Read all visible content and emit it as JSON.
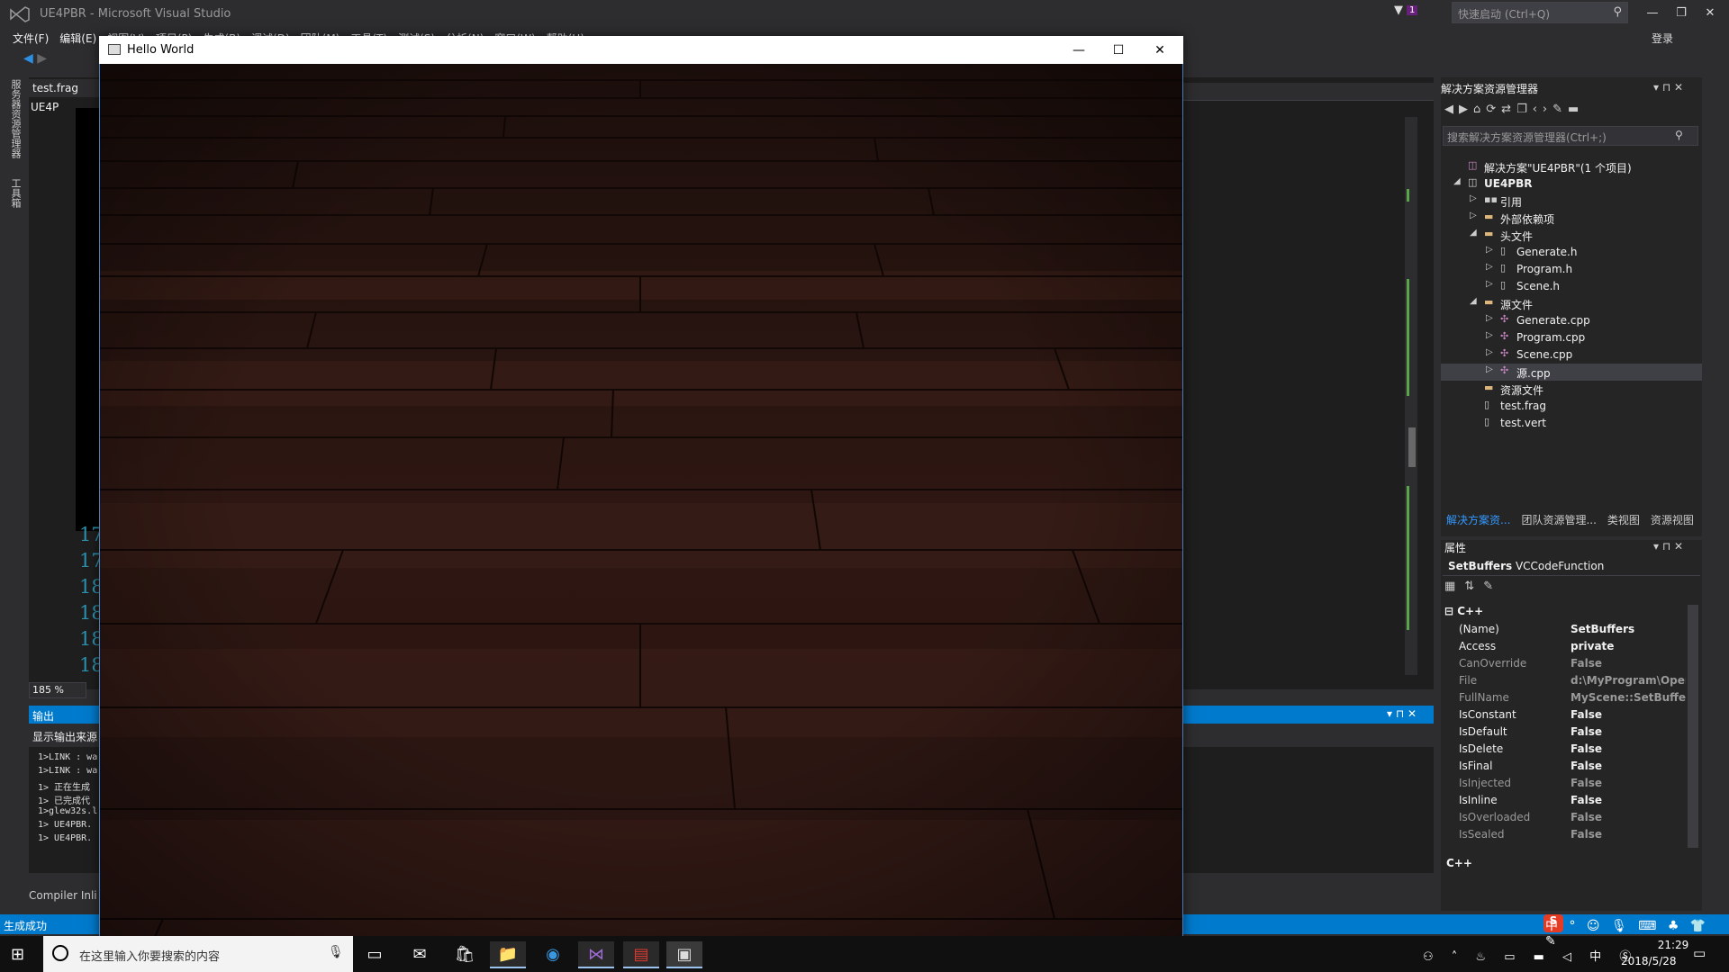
{
  "vs": {
    "title": "UE4PBR - Microsoft Visual Studio",
    "quick_launch": "快速启动 (Ctrl+Q)",
    "login": "登录",
    "notify_count": "1",
    "menu": [
      "文件(F)",
      "编辑(E)",
      "视图(V)",
      "项目(P)",
      "生成(B)",
      "调试(D)",
      "团队(M)",
      "工具(T)",
      "测试(S)",
      "分析(N)",
      "窗口(W)",
      "帮助(H)"
    ],
    "left_tabs": [
      "服务器资源管理器",
      "工具箱"
    ],
    "editor_tab": "test.frag",
    "editor_file": "UE4P",
    "line_numbers": [
      "17",
      "17",
      "18",
      "18",
      "18",
      "18"
    ],
    "zoom": "185 %",
    "output": {
      "title": "输出",
      "source_label": "显示输出来源",
      "lines": [
        "1>LINK : wa",
        "1>LINK : wa",
        "1>  正在生成",
        "1>  已完成代",
        "1>glew32s.l",
        "1>  UE4PBR.",
        "1>  UE4PBR."
      ],
      "footer": "Compiler Inli"
    },
    "status": "生成成功"
  },
  "solution_explorer": {
    "title": "解决方案资源管理器",
    "search_placeholder": "搜索解决方案资源管理器(Ctrl+;)",
    "tree": [
      {
        "label": "解决方案\"UE4PBR\"(1 个项目)",
        "level": 0,
        "expander": "",
        "icon": "solution-icon"
      },
      {
        "label": "UE4PBR",
        "level": 0,
        "expander": "◢",
        "icon": "project-icon"
      },
      {
        "label": "引用",
        "level": 1,
        "expander": "▷",
        "icon": "references-icon"
      },
      {
        "label": "外部依赖项",
        "level": 1,
        "expander": "▷",
        "icon": "folder-icon"
      },
      {
        "label": "头文件",
        "level": 1,
        "expander": "◢",
        "icon": "folder-icon"
      },
      {
        "label": "Generate.h",
        "level": 2,
        "expander": "▷",
        "icon": "header-file-icon"
      },
      {
        "label": "Program.h",
        "level": 2,
        "expander": "▷",
        "icon": "header-file-icon"
      },
      {
        "label": "Scene.h",
        "level": 2,
        "expander": "▷",
        "icon": "header-file-icon"
      },
      {
        "label": "源文件",
        "level": 1,
        "expander": "◢",
        "icon": "folder-icon"
      },
      {
        "label": "Generate.cpp",
        "level": 2,
        "expander": "▷",
        "icon": "cpp-file-icon"
      },
      {
        "label": "Program.cpp",
        "level": 2,
        "expander": "▷",
        "icon": "cpp-file-icon"
      },
      {
        "label": "Scene.cpp",
        "level": 2,
        "expander": "▷",
        "icon": "cpp-file-icon"
      },
      {
        "label": "源.cpp",
        "level": 2,
        "expander": "▷",
        "icon": "cpp-file-icon",
        "selected": true
      },
      {
        "label": "资源文件",
        "level": 1,
        "expander": "",
        "icon": "folder-icon"
      },
      {
        "label": "test.frag",
        "level": 1,
        "expander": "",
        "icon": "file-icon"
      },
      {
        "label": "test.vert",
        "level": 1,
        "expander": "",
        "icon": "file-icon"
      }
    ],
    "tabs": [
      "解决方案资...",
      "团队资源管理...",
      "类视图",
      "资源视图"
    ]
  },
  "properties": {
    "title": "属性",
    "object_name": "SetBuffers",
    "object_type": "VCCodeFunction",
    "category": "C++",
    "rows": [
      {
        "name": "(Name)",
        "value": "SetBuffers",
        "dim": false
      },
      {
        "name": "Access",
        "value": "private",
        "dim": false
      },
      {
        "name": "CanOverride",
        "value": "False",
        "dim": true
      },
      {
        "name": "File",
        "value": "d:\\MyProgram\\Oper",
        "dim": true
      },
      {
        "name": "FullName",
        "value": "MyScene::SetBuffers",
        "dim": true
      },
      {
        "name": "IsConstant",
        "value": "False",
        "dim": false
      },
      {
        "name": "IsDefault",
        "value": "False",
        "dim": false
      },
      {
        "name": "IsDelete",
        "value": "False",
        "dim": false
      },
      {
        "name": "IsFinal",
        "value": "False",
        "dim": false
      },
      {
        "name": "IsInjected",
        "value": "False",
        "dim": true
      },
      {
        "name": "IsInline",
        "value": "False",
        "dim": false
      },
      {
        "name": "IsOverloaded",
        "value": "False",
        "dim": true
      },
      {
        "name": "IsSealed",
        "value": "False",
        "dim": true
      }
    ],
    "description": "C++"
  },
  "hello_window": {
    "title": "Hello World"
  },
  "taskbar": {
    "search_placeholder": "在这里输入你要搜索的内容",
    "time": "21:29",
    "date": "2018/5/28",
    "ime_lang": "中"
  },
  "colors": {
    "accent": "#007acc",
    "vs_bg": "#2d2d30",
    "wood": "#3a1d17"
  }
}
